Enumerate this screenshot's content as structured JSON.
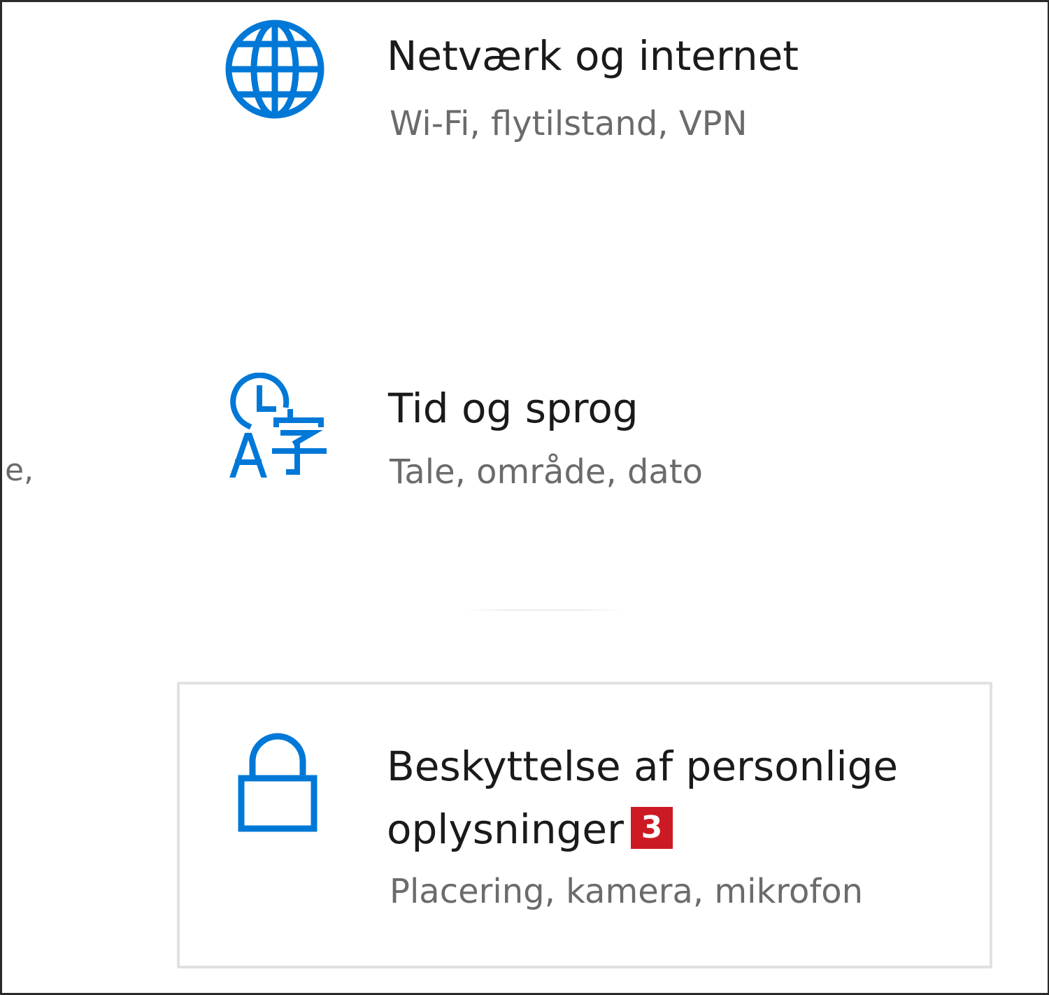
{
  "left_fragment": "e,",
  "tiles": [
    {
      "title": "Netværk og internet",
      "description": "Wi-Fi, flytilstand, VPN",
      "icon": "globe-icon"
    },
    {
      "title": "Tid og sprog",
      "description": "Tale, område, dato",
      "icon": "time-language-icon"
    },
    {
      "title": "Beskyttelse af personlige oplysninger",
      "description": "Placering, kamera, mikrofon",
      "icon": "lock-icon",
      "badge": "3"
    }
  ],
  "colors": {
    "accent": "#0078d7",
    "title_text": "#1a1a1a",
    "description_text": "#6b6b6b",
    "badge": "#cc1a24",
    "selection_border": "#e1e1e1",
    "background": "#ffffff"
  }
}
